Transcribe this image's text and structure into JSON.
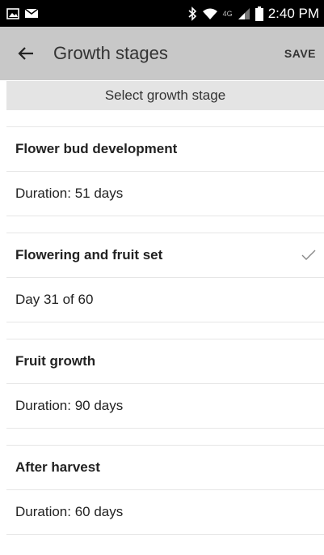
{
  "status_bar": {
    "time": "2:40 PM",
    "network": "4G"
  },
  "toolbar": {
    "title": "Growth stages",
    "save_label": "SAVE"
  },
  "subheader": "Select growth stage",
  "stages": [
    {
      "name": "Flower bud development",
      "detail": "Duration: 51 days",
      "selected": false
    },
    {
      "name": "Flowering and fruit set",
      "detail": "Day 31 of 60",
      "selected": true
    },
    {
      "name": "Fruit growth",
      "detail": "Duration: 90 days",
      "selected": false
    },
    {
      "name": "After harvest",
      "detail": "Duration: 60 days",
      "selected": false
    }
  ],
  "colors": {
    "toolbar": "#c8c8c8",
    "subheader": "#e4e4e4",
    "statusbar": "#000000"
  }
}
